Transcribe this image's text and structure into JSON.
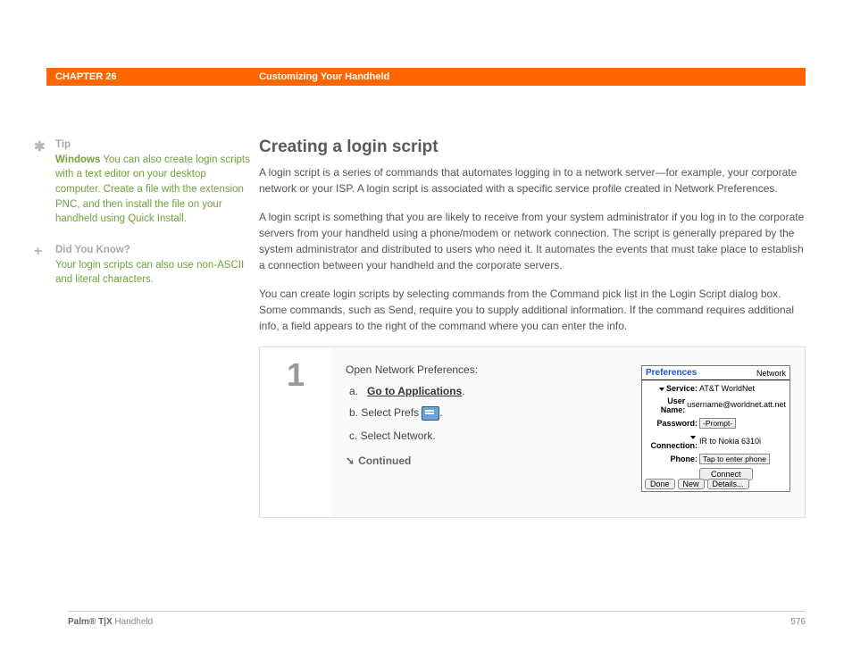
{
  "header": {
    "chapter": "CHAPTER 26",
    "title": "Customizing Your Handheld"
  },
  "sidebar": {
    "tip": {
      "head": "Tip",
      "lead": "Windows",
      "text": "You can also create login scripts with a text editor on your desktop computer. Create a file with the extension PNC, and then install the file on your handheld using Quick Install."
    },
    "dyk": {
      "head": "Did You Know?",
      "text": "Your login scripts can also use non-ASCII and literal characters."
    }
  },
  "main": {
    "title": "Creating a login script",
    "p1": "A login script is a series of commands that automates logging in to a network server—for example, your corporate network or your ISP. A login script is associated with a specific service profile created in Network Preferences.",
    "p2": "A login script is something that you are likely to receive from your system administrator if you log in to the corporate servers from your handheld using a phone/modem or network connection. The script is generally prepared by the system administrator and distributed to users who need it. It automates the events that must take place to establish a connection between your handheld and the corporate servers.",
    "p3": "You can create login scripts by selecting commands from the Command pick list in the Login Script dialog box. Some commands, such as Send, require you to supply additional information. If the command requires additional info, a field appears to the right of the command where you can enter the info."
  },
  "step": {
    "number": "1",
    "intro": "Open Network Preferences:",
    "a_prefix": "a.",
    "a_link": "Go to Applications",
    "a_period": ".",
    "b": "b.   Select Prefs ",
    "b_period": ".",
    "c": "c.   Select Network.",
    "continued": "Continued"
  },
  "screenshot": {
    "title": "Preferences",
    "corner": "Network",
    "service_label": "Service:",
    "service_val": "AT&T WorldNet",
    "user_label": "User Name:",
    "user_val": "username@worldnet.att.net",
    "pass_label": "Password:",
    "pass_val": "-Prompt-",
    "conn_label": "Connection:",
    "conn_val": "IR to Nokia 6310i",
    "phone_label": "Phone:",
    "phone_val": "Tap to enter phone",
    "connect": "Connect",
    "done": "Done",
    "new": "New",
    "details": "Details..."
  },
  "footer": {
    "product_bold": "Palm® T|X",
    "product_rest": " Handheld",
    "page": "576"
  }
}
